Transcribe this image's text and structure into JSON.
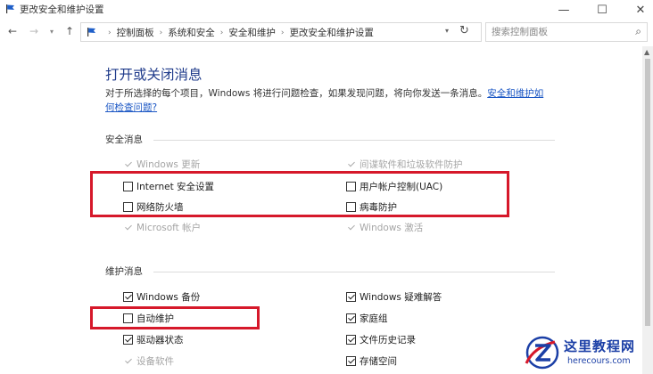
{
  "window": {
    "title": "更改安全和维护设置",
    "minimize": "—",
    "maximize": "☐",
    "close": "✕"
  },
  "nav": {
    "back": "←",
    "forward": "→",
    "recent": "▾",
    "up": "↑",
    "breadcrumbs": [
      "控制面板",
      "系统和安全",
      "安全和维护",
      "更改安全和维护设置"
    ],
    "separator": "›",
    "refresh": "↻",
    "search_placeholder": "搜索控制面板",
    "search_icon": "⌕"
  },
  "main": {
    "heading": "打开或关闭消息",
    "desc_text": "对于所选择的每个项目，Windows 将进行问题检查，如果发现问题，将向你发送一条消息。",
    "desc_link1": "安全和维护如",
    "desc_link2": "何检查问题?",
    "security": {
      "label": "安全消息",
      "items": [
        {
          "label": "Windows 更新",
          "checked": true,
          "disabled": true
        },
        {
          "label": "间谍软件和垃圾软件防护",
          "checked": true,
          "disabled": true
        },
        {
          "label": "Internet 安全设置",
          "checked": false,
          "disabled": false
        },
        {
          "label": "用户帐户控制(UAC)",
          "checked": false,
          "disabled": false
        },
        {
          "label": "网络防火墙",
          "checked": false,
          "disabled": false
        },
        {
          "label": "病毒防护",
          "checked": false,
          "disabled": false
        },
        {
          "label": "Microsoft 帐户",
          "checked": true,
          "disabled": true
        },
        {
          "label": "Windows 激活",
          "checked": true,
          "disabled": true
        }
      ]
    },
    "maintenance": {
      "label": "维护消息",
      "items": [
        {
          "label": "Windows 备份",
          "checked": true,
          "disabled": false
        },
        {
          "label": "Windows 疑难解答",
          "checked": true,
          "disabled": false
        },
        {
          "label": "自动维护",
          "checked": false,
          "disabled": false
        },
        {
          "label": "家庭组",
          "checked": true,
          "disabled": false
        },
        {
          "label": "驱动器状态",
          "checked": true,
          "disabled": false
        },
        {
          "label": "文件历史记录",
          "checked": true,
          "disabled": false
        },
        {
          "label": "设备软件",
          "checked": true,
          "disabled": true
        },
        {
          "label": "存储空间",
          "checked": true,
          "disabled": false
        }
      ]
    }
  },
  "colors": {
    "highlight": "#d6182a",
    "heading": "#1e3a8a",
    "link": "#1a56c4"
  },
  "watermark": {
    "cn": "这里教程网",
    "en": "herecours.com"
  }
}
